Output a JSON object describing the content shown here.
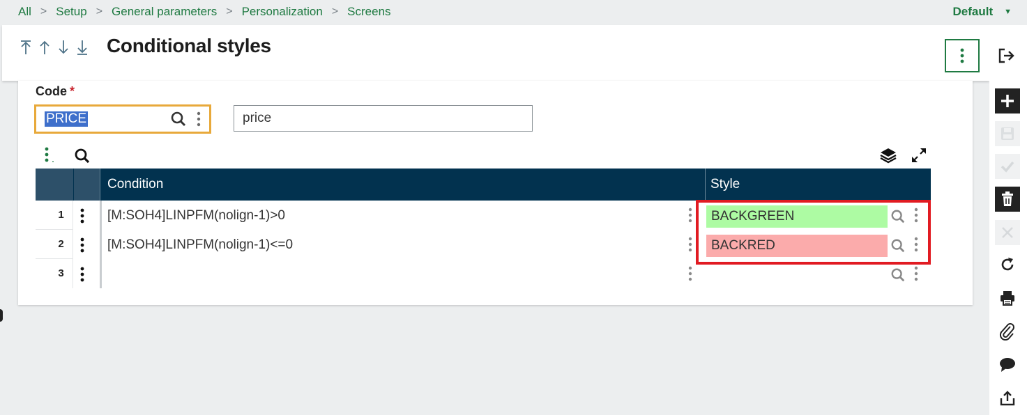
{
  "breadcrumb": [
    "All",
    "Setup",
    "General parameters",
    "Personalization",
    "Screens"
  ],
  "default_selector": "Default",
  "page": {
    "title": "Conditional styles"
  },
  "form": {
    "code_label": "Code",
    "required_mark": "*",
    "code_value": "PRICE",
    "description_value": "price"
  },
  "grid": {
    "columns": [
      "Condition",
      "Style"
    ],
    "rows": [
      {
        "num": "1",
        "condition": "[M:SOH4]LINPFM(nolign-1)>0",
        "style": "BACKGREEN",
        "style_color": "#adfba3"
      },
      {
        "num": "2",
        "condition": "[M:SOH4]LINPFM(nolign-1)<=0",
        "style": "BACKRED",
        "style_color": "#fbabab"
      },
      {
        "num": "3",
        "condition": "",
        "style": "",
        "style_color": ""
      }
    ]
  },
  "colors": {
    "accent": "#1f7a42",
    "header_dark": "#02324f",
    "focus": "#e8a93b",
    "highlight_box": "#e11b22"
  },
  "icons": [
    "first-icon",
    "previous-icon",
    "next-icon",
    "last-icon",
    "more-vertical-icon",
    "exit-icon",
    "add-icon",
    "save-icon",
    "ok-icon",
    "delete-icon",
    "cancel-icon",
    "refresh-icon",
    "print-icon",
    "attachment-icon",
    "comment-icon",
    "export-icon",
    "search-icon",
    "layers-icon",
    "expand-icon"
  ]
}
